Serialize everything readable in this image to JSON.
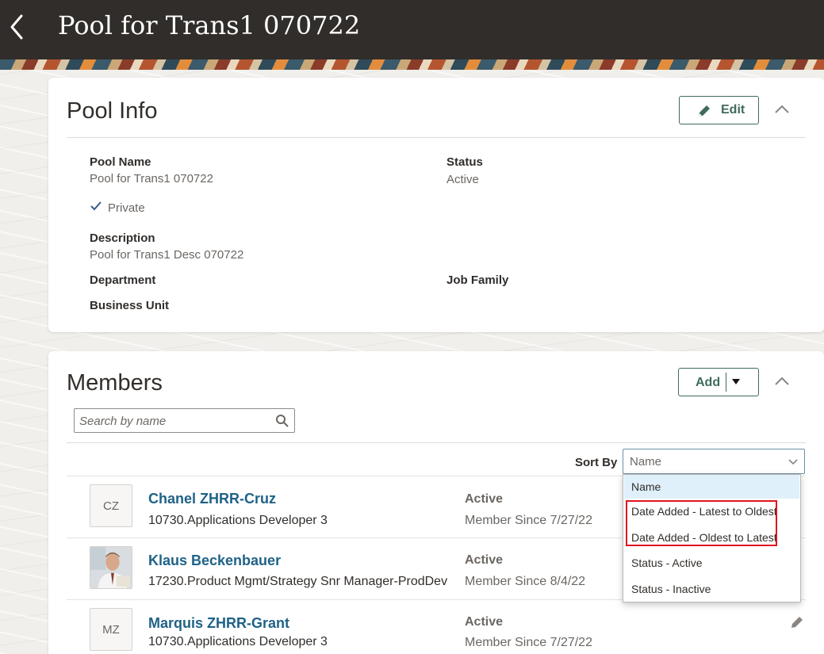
{
  "header": {
    "title": "Pool for Trans1 070722"
  },
  "pool_info": {
    "heading": "Pool Info",
    "edit_label": "Edit",
    "fields": {
      "pool_name_label": "Pool Name",
      "pool_name_value": "Pool for Trans1 070722",
      "status_label": "Status",
      "status_value": "Active",
      "private_label": "Private",
      "description_label": "Description",
      "description_value": "Pool for Trans1 Desc 070722",
      "department_label": "Department",
      "job_family_label": "Job Family",
      "business_unit_label": "Business Unit"
    }
  },
  "members": {
    "heading": "Members",
    "add_label": "Add",
    "search_placeholder": "Search by name",
    "sort_label": "Sort By",
    "sort_selected": "Name",
    "sort_options": [
      "Name",
      "Date Added - Latest to Oldest",
      "Date Added - Oldest to Latest",
      "Status - Active",
      "Status - Inactive"
    ],
    "rows": [
      {
        "initials": "CZ",
        "name": "Chanel ZHRR-Cruz",
        "job": "10730.Applications Developer 3",
        "status": "Active",
        "since": "Member Since 7/27/22"
      },
      {
        "initials": "",
        "name": "Klaus Beckenbauer",
        "job": "17230.Product Mgmt/Strategy Snr Manager-ProdDev",
        "status": "Active",
        "since": "Member Since 8/4/22"
      },
      {
        "initials": "MZ",
        "name": "Marquis ZHRR-Grant",
        "job": "10730.Applications Developer 3",
        "status": "Active",
        "since": "Member Since 7/27/22"
      }
    ]
  }
}
